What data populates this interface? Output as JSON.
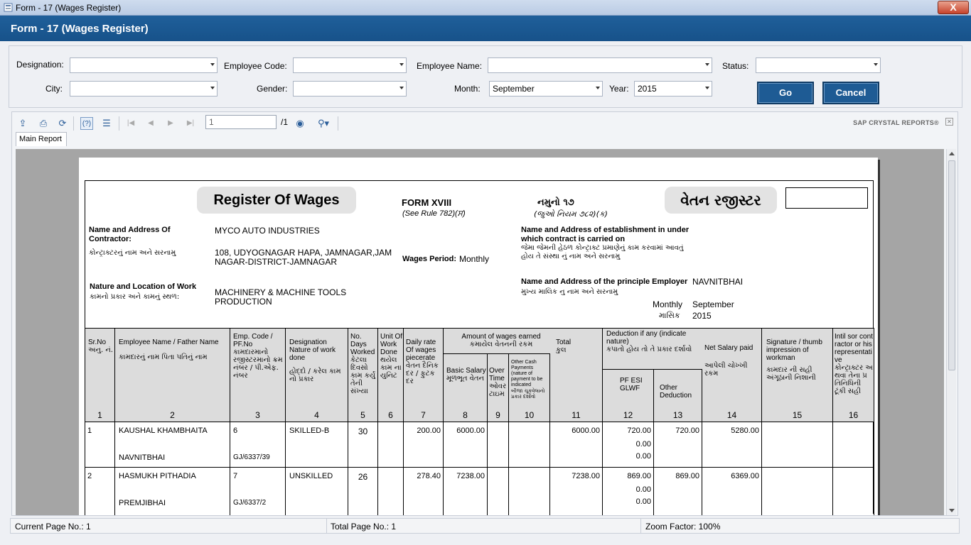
{
  "window": {
    "title": "Form - 17 (Wages Register)",
    "close": "X"
  },
  "header": {
    "title": "Form - 17 (Wages Register)"
  },
  "filters": {
    "designation_label": "Designation:",
    "designation_value": "",
    "employee_code_label": "Employee Code:",
    "employee_code_value": "",
    "employee_name_label": "Employee Name:",
    "employee_name_value": "",
    "status_label": "Status:",
    "status_value": "",
    "city_label": "City:",
    "city_value": "",
    "gender_label": "Gender:",
    "gender_value": "",
    "month_label": "Month:",
    "month_value": "September",
    "year_label": "Year:",
    "year_value": "2015",
    "go_label": "Go",
    "cancel_label": "Cancel"
  },
  "viewer": {
    "page_input": "1",
    "page_total": "/1",
    "brand": "SAP CRYSTAL REPORTS®",
    "tab_main": "Main Report"
  },
  "report": {
    "title_en": "Register Of Wages",
    "form_no": "FORM XVIII",
    "form_rule": "(See Rule 782)(ਸ)",
    "form_no_guj": "નમુનો ૧૭",
    "form_rule_guj": "(જુઓ નિયમ ૭૮૨)(ક)",
    "title_guj": "વેતન રજીસ્ટર",
    "contractor_label": "Name and Address Of Contractor:",
    "contractor_label_guj": "કોન્ટ્રાક્ટરનું નામ અને સરનામુ",
    "contractor_name": "MYCO AUTO INDUSTRIES",
    "contractor_address": "108, UDYOGNAGAR HAPA, JAMNAGAR,JAMNAGAR-DISTRICT-JAMNAGAR",
    "work_label": "Nature and Location of Work",
    "work_label_guj": "કામનો પ્રકાર અને કામનું સ્થળ:",
    "work_value": "MACHINERY & MACHINE TOOLS PRODUCTION",
    "wages_period_label": "Wages Period:",
    "wages_period_value": "Monthly",
    "establishment_label": "Name and Address of establishment in under which contract is carried on",
    "establishment_label_guj": "જેમા જેમની હેઠળ કોન્ટ્રાક્ટ પ્રમાણેનું કામ કરવામાં આવતું હોય તે સંસ્થા નું નામ અને સરનામુ",
    "principal_label": "Name and Address of the principle Employer",
    "principal_label_guj": "મુખ્ય માલિક નુ નામ અને સરનામુ",
    "principal_value": "NAVNITBHAI",
    "monthly_label": "Monthly",
    "monthly_label_guj": "માસિક",
    "month_value": "September",
    "year_value": "2015"
  },
  "table": {
    "headers": [
      {
        "en": "Sr.No",
        "guj": "અનુ. નં.",
        "num": "1"
      },
      {
        "en": "Employee Name / Father Name",
        "guj": "કામદારનું નામ પિતા પતિનું નામ",
        "num": "2"
      },
      {
        "en": "Emp. Code / PF.No",
        "guj": "કામદારમાનો રજીસ્ટરમાનો ક્રમ નંબર / પી.એફ. નંબર",
        "num": "3"
      },
      {
        "en": "Designation Nature of work done",
        "guj": "હોદ્દો / કરેલ કામ નો પ્રકાર",
        "num": "4"
      },
      {
        "en": "No. Days Worked",
        "guj": "કેટલા દિવસો કામ કર્યું તેની સંખ્યા",
        "num": "5"
      },
      {
        "en": "Unit Of Work Done",
        "guj": "થયેલ કામ ના યુનિટ",
        "num": "6"
      },
      {
        "en": "Daily rate Of wages piecerate",
        "guj": "વેતન દૈનિક દર / ફુટક દર",
        "num": "7"
      },
      {
        "en": "Basic Salary",
        "guj": "મૂળભૂત વેતન",
        "num": "8"
      },
      {
        "en": "Over Time",
        "guj": "ઓવર ટાઇમ",
        "num": "9"
      },
      {
        "en": "Other Cash Payments (nature of payment to be indicated",
        "guj": "બીજા ચૂકવેલાનો પ્રકાર દર્શાવો",
        "num": "10"
      },
      {
        "en": "Total",
        "guj": "કુલ",
        "num": "11"
      },
      {
        "en": "PF ESI GLWF",
        "guj": "",
        "num": "12"
      },
      {
        "en": "Other Deduction",
        "guj": "",
        "num": "13"
      },
      {
        "en": "Net Salary paid",
        "guj": "આપેલી ચોખ્ખી રકમ",
        "num": "14"
      },
      {
        "en": "Signature / thumb impression of workman",
        "guj": "કામદાર ની સહી અંગૂઠાની નિશાની",
        "num": "15"
      },
      {
        "en": "Intil sor contractor or his representative",
        "guj": "કોન્ટ્રાક્ટર અથવા તેના પ્રતિનિધિની ટૂંકી સહી",
        "num": "16"
      }
    ],
    "group_wages": {
      "en": "Amount of wages earned",
      "guj": "કમાયેલ વેતનની રકમ"
    },
    "group_deduction": {
      "en": "Deduction if any (indicate nature)",
      "guj": "કપાતો હોય તો તે પ્રકાર દર્શાવો"
    },
    "rows": [
      {
        "sr": "1",
        "name": "KAUSHAL KHAMBHAITA",
        "father": "NAVNITBHAI",
        "code": "6",
        "pf": "GJ/6337/39",
        "designation": "SKILLED-B",
        "days": "30",
        "rate": "200.00",
        "basic": "6000.00",
        "total": "6000.00",
        "pf_amt": "720.00",
        "esi": "0.00",
        "glwf": "0.00",
        "other_ded": "720.00",
        "net": "5280.00"
      },
      {
        "sr": "2",
        "name": "HASMUKH PITHADIA",
        "father": "PREMJIBHAI",
        "code": "7",
        "pf": "GJ/6337/2",
        "designation": "UNSKILLED",
        "days": "26",
        "rate": "278.40",
        "basic": "7238.00",
        "total": "7238.00",
        "pf_amt": "869.00",
        "esi": "0.00",
        "glwf": "0.00",
        "other_ded": "869.00",
        "net": "6369.00"
      }
    ]
  },
  "statusbar": {
    "current_page": "Current Page No.: 1",
    "total_page": "Total Page No.: 1",
    "zoom": "Zoom Factor: 100%"
  }
}
